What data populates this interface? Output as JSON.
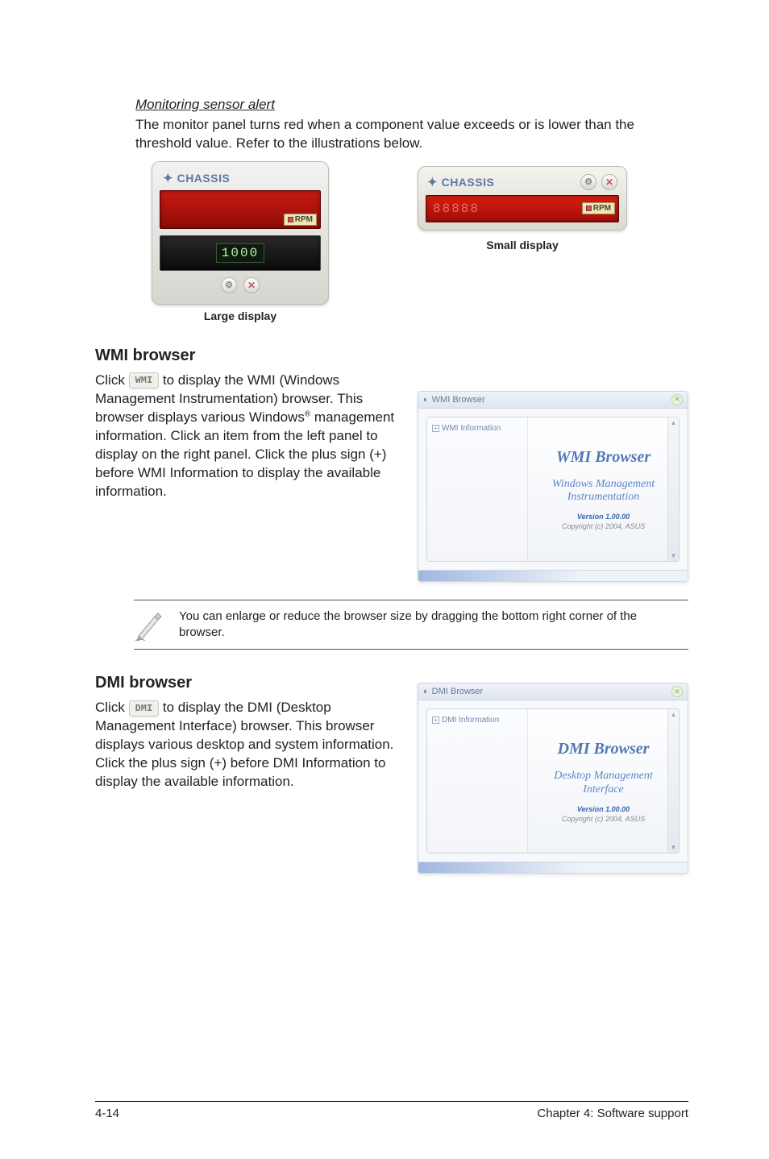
{
  "section_monitor": {
    "heading": "Monitoring sensor alert",
    "body": "The monitor panel turns red when a component value exceeds or is lower than the threshold value. Refer to the illustrations below.",
    "large": {
      "title": "CHASSIS",
      "rpm_label": "RPM",
      "digits": "1000",
      "caption": "Large display"
    },
    "small": {
      "title": "CHASSIS",
      "rpm_label": "RPM",
      "caption": "Small display"
    }
  },
  "wmi": {
    "heading": "WMI browser",
    "click": "Click",
    "chip": "WMI",
    "body1": " to display the WMI (Windows Management Instrumentation) browser. This browser displays various Windows",
    "reg": "®",
    "body2": " management information. Click an item from the left panel to display on the right panel. Click the plus sign (+) before WMI Information to display the available information.",
    "window": {
      "titlebar": "WMI Browser",
      "tree": "WMI Information",
      "big": "WMI  Browser",
      "sub1": "Windows Management",
      "sub2": "Instrumentation",
      "version": "Version 1.00.00",
      "copy": "Copyright (c) 2004,  ASUS"
    }
  },
  "note": {
    "text": "You can enlarge or reduce the browser size by dragging the bottom right corner of the browser."
  },
  "dmi": {
    "heading": "DMI browser",
    "click": "Click",
    "chip": "DMI",
    "body": " to display the DMI (Desktop Management Interface) browser. This browser displays various desktop and system information. Click the plus sign (+) before DMI Information to display the available information.",
    "window": {
      "titlebar": "DMI Browser",
      "tree": "DMI Information",
      "big": "DMI  Browser",
      "sub1": "Desktop Management",
      "sub2": "Interface",
      "version": "Version 1.00.00",
      "copy": "Copyright (c) 2004,  ASUS"
    }
  },
  "footer": {
    "left": "4-14",
    "right": "Chapter 4: Software support"
  }
}
